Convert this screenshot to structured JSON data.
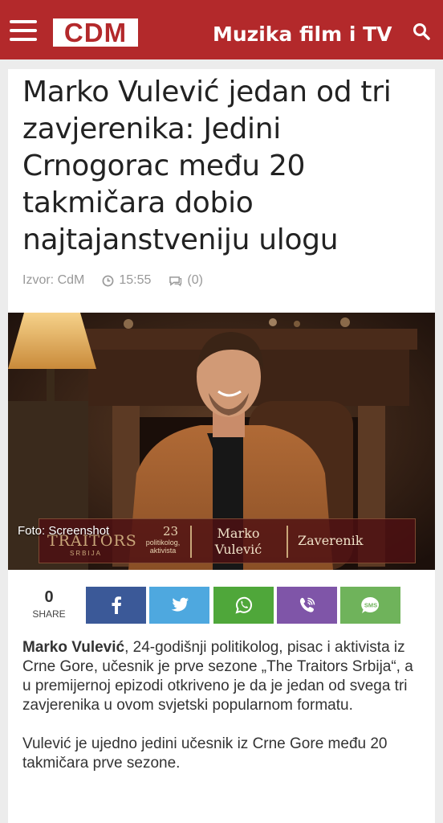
{
  "header": {
    "logo": "CDM",
    "section": "Muzika film i TV",
    "colors": {
      "brand": "#b3292b"
    }
  },
  "article": {
    "title": "Marko Vulević jedan od tri zavjerenika: Jedini Crnogorac među 20 takmičara dobio najtajanstveniju ulogu",
    "source": "Izvor: CdM",
    "time": "15:55",
    "comments": "(0)",
    "image": {
      "caption": "Foto: Screenshot",
      "banner": {
        "show": "TRAITORS",
        "show_sub": "SRBIJA",
        "age": "23",
        "role_line1": "politikolog,",
        "role_line2": "aktivista",
        "name_line1": "Marko",
        "name_line2": "Vulević",
        "label": "Zaverenik"
      }
    },
    "share": {
      "count": "0",
      "label": "SHARE",
      "buttons": [
        "facebook-icon",
        "twitter-icon",
        "whatsapp-icon",
        "viber-icon",
        "sms-icon"
      ],
      "sms_text": "SMS"
    },
    "paragraphs": [
      {
        "bold": "Marko Vulević",
        "text": ", 24-godišnji politikolog, pisac i aktivista iz Crne Gore, učesnik je prve sezone „The Traitors Srbija“, a u premijernoj epizodi otkriveno je da je jedan od svega tri zavjerenika u ovom svjetski popularnom formatu."
      },
      {
        "bold": "",
        "text": "Vulević je ujedno jedini učesnik iz Crne Gore među 20 takmičara prve sezone."
      }
    ]
  }
}
